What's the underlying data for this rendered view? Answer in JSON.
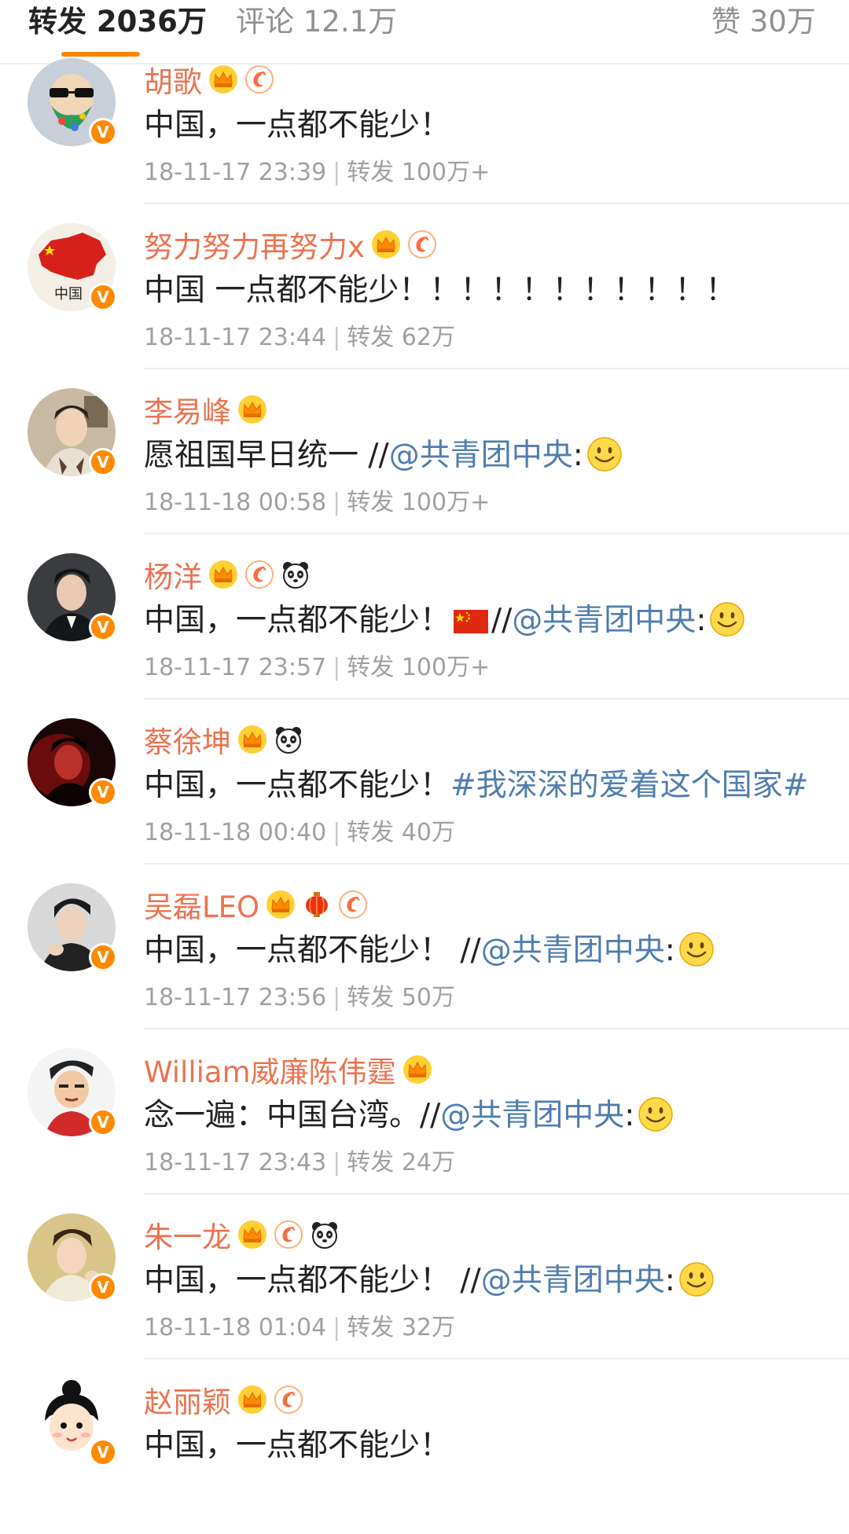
{
  "tabs": {
    "repost": "转发 2036万",
    "comments": "评论 12.1万",
    "likes": "赞 30万"
  },
  "accent_color": "#ff8200",
  "name_color": "#eb7350",
  "link_color": "#507daf",
  "reposts": [
    {
      "name": "胡歌",
      "badges": [
        "crown-icon",
        "shrimp-icon"
      ],
      "text": "中国，一点都不能少！",
      "date": "18-11-17 23:39",
      "repost_label": "转发 100万+"
    },
    {
      "name": "努力努力再努力x",
      "badges": [
        "crown-icon",
        "shrimp-icon"
      ],
      "text": "中国 一点都不能少！！！！！！！！！！！",
      "date": "18-11-17 23:44",
      "repost_label": "转发 62万"
    },
    {
      "name": "李易峰",
      "badges": [
        "crown-icon"
      ],
      "text": "愿祖国早日统一 //",
      "mention": "@共青团中央",
      "colon": ":",
      "date": "18-11-18 00:58",
      "repost_label": "转发 100万+"
    },
    {
      "name": "杨洋",
      "badges": [
        "crown-icon",
        "shrimp-icon",
        "panda-icon"
      ],
      "text": "中国，一点都不能少！",
      "suffix": "//",
      "mention": "@共青团中央",
      "colon": ":",
      "date": "18-11-17 23:57",
      "repost_label": "转发 100万+"
    },
    {
      "name": "蔡徐坤",
      "badges": [
        "crown-icon",
        "panda-icon"
      ],
      "text": "中国，一点都不能少！",
      "hashtag": "#我深深的爱着这个国家#",
      "date": "18-11-18 00:40",
      "repost_label": "转发 40万"
    },
    {
      "name": "吴磊LEO",
      "badges": [
        "crown-icon",
        "lantern-icon",
        "shrimp-icon"
      ],
      "text": "中国，一点都不能少！ //",
      "mention": "@共青团中央",
      "colon": ":",
      "date": "18-11-17 23:56",
      "repost_label": "转发 50万"
    },
    {
      "name": "William威廉陈伟霆",
      "badges": [
        "crown-icon"
      ],
      "text": "念一遍：中国台湾。//",
      "mention": "@共青团中央",
      "colon": ":",
      "date": "18-11-17 23:43",
      "repost_label": "转发 24万"
    },
    {
      "name": "朱一龙",
      "badges": [
        "crown-icon",
        "shrimp-icon",
        "panda-icon"
      ],
      "text": "中国，一点都不能少！ //",
      "mention": "@共青团中央",
      "colon": ":",
      "date": "18-11-18 01:04",
      "repost_label": "转发 32万"
    },
    {
      "name": "赵丽颖",
      "badges": [
        "crown-icon",
        "shrimp-icon"
      ],
      "text": "中国，一点都不能少！"
    }
  ]
}
